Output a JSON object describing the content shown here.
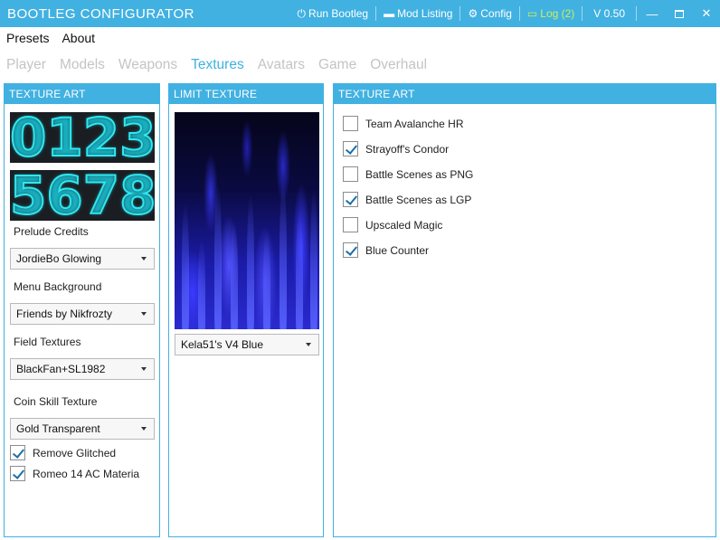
{
  "app": {
    "title": "BOOTLEG CONFIGURATOR"
  },
  "titlebar": {
    "run_label": "Run Bootleg",
    "mod_listing_label": "Mod Listing",
    "config_label": "Config",
    "log_label": "Log (2)",
    "version": "V 0.50",
    "minimize_glyph": "—",
    "close_glyph": "✕"
  },
  "menu": {
    "items": [
      "Presets",
      "About"
    ]
  },
  "tabs": {
    "items": [
      "Player",
      "Models",
      "Weapons",
      "Textures",
      "Avatars",
      "Game",
      "Overhaul"
    ],
    "active": "Textures"
  },
  "panel_left": {
    "title": "TEXTURE ART",
    "digits_row1": [
      "0",
      "1",
      "2",
      "3"
    ],
    "digits_row2": [
      "5",
      "6",
      "7",
      "8"
    ],
    "prelude_label": "Prelude Credits",
    "prelude_value": "JordieBo Glowing",
    "menu_bg_label": "Menu Background",
    "menu_bg_value": "Friends by Nikfrozty",
    "field_label": "Field Textures",
    "field_value": "BlackFan+SL1982",
    "coin_label": "Coin Skill Texture",
    "coin_value": "Gold Transparent",
    "remove_glitched_label": "Remove Glitched",
    "remove_glitched_checked": true,
    "romeo_label": "Romeo 14 AC Materia",
    "romeo_checked": true
  },
  "panel_mid": {
    "title": "LIMIT TEXTURE",
    "limit_value": "Kela51's V4 Blue"
  },
  "panel_right": {
    "title": "TEXTURE ART",
    "options": [
      {
        "label": "Team Avalanche HR",
        "checked": false
      },
      {
        "label": "Strayoff's Condor",
        "checked": true
      },
      {
        "label": "Battle Scenes as PNG",
        "checked": false
      },
      {
        "label": "Battle Scenes as LGP",
        "checked": true
      },
      {
        "label": "Upscaled Magic",
        "checked": false
      },
      {
        "label": "Blue Counter",
        "checked": true
      }
    ]
  },
  "colors": {
    "accent": "#41b1e1",
    "log": "#c8f060",
    "tab_inactive": "#c4c4c4",
    "digits": "#2ee8f0"
  },
  "icons": {
    "run": "power-icon",
    "mod_listing": "folder-icon",
    "config": "gear-icon"
  }
}
